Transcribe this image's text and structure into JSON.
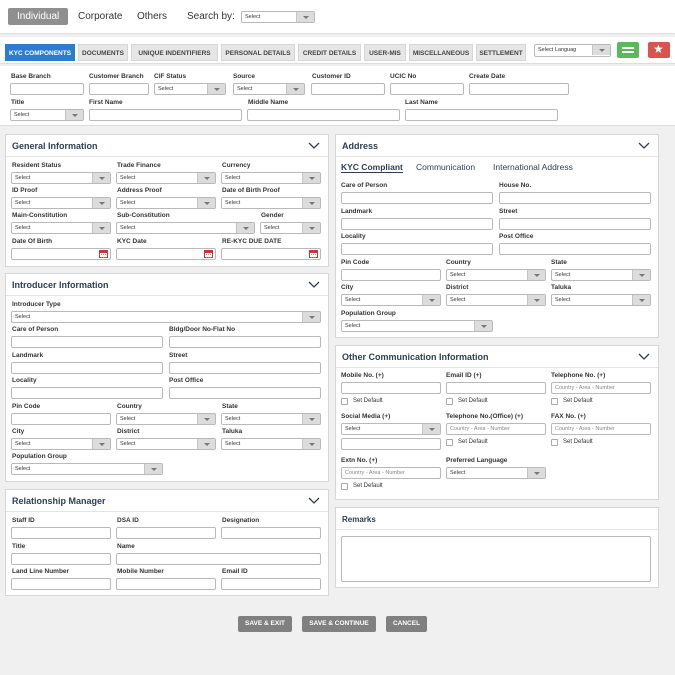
{
  "top_tabs": {
    "individual": "Individual",
    "corporate": "Corporate",
    "others": "Others",
    "search_by": "Search by:",
    "search_select": "Select"
  },
  "nav_tabs": [
    "KYC COMPONENTS",
    "DOCUMENTS",
    "UNIQUE INDENTIFIERS",
    "PERSONAL DETAILS",
    "CREDIT DETAILS",
    "USER-MIS",
    "MISCELLANEOUS",
    "SETTLEMENT"
  ],
  "language_select": "Select Languag",
  "select_text": "Select",
  "header_form": {
    "base_branch": "Base Branch",
    "customer_branch": "Customer Branch",
    "cif_status": "CIF Status",
    "source": "Source",
    "customer_id": "Customer ID",
    "ucic_no": "UCIC No",
    "create_date": "Create Date",
    "title": "Title",
    "first_name": "First Name",
    "middle_name": "Middle Name",
    "last_name": "Last Name"
  },
  "general": {
    "title": "General Information",
    "resident_status": "Resident Status",
    "trade_finance": "Trade Finance",
    "currency": "Currency",
    "id_proof": "ID Proof",
    "address_proof": "Address Proof",
    "dob_proof": "Date of Birth Proof",
    "main_constitution": "Main-Constitution",
    "sub_constitution": "Sub-Constitution",
    "gender": "Gender",
    "date_of_birth": "Date Of Birth",
    "kyc_date": "KYC Date",
    "rekyc_due": "RE-KYC DUE DATE"
  },
  "address": {
    "title": "Address",
    "tabs": [
      "KYC Compliant",
      "Communication",
      "International Address"
    ],
    "care_of": "Care of Person",
    "house_no": "House No.",
    "landmark": "Landmark",
    "street": "Street",
    "locality": "Locality",
    "post_office": "Post Office",
    "pin_code": "Pin Code",
    "country": "Country",
    "state": "State",
    "city": "City",
    "district": "District",
    "taluka": "Taluka",
    "population_group": "Population Group"
  },
  "introducer": {
    "title": "Introducer Information",
    "type": "Introducer Type",
    "care_of": "Care of Person",
    "bldg": "Bldg/Door No-Flat No",
    "landmark": "Landmark",
    "street": "Street",
    "locality": "Locality",
    "post_office": "Post Office",
    "pin_code": "Pin Code",
    "country": "Country",
    "state": "State",
    "city": "City",
    "district": "District",
    "taluka": "Taluka",
    "population_group": "Population Group"
  },
  "other_comm": {
    "title": "Other Communication Information",
    "mobile": "Mobile No. (+)",
    "email": "Email ID (+)",
    "telephone": "Telephone No. (+)",
    "set_default": "Set Default",
    "social": "Social Media (+)",
    "tel_office": "Telephone No.(Office) (+)",
    "fax": "FAX No. (+)",
    "extn": "Extn No. (+)",
    "preferred_language": "Preferred Language",
    "phone_placeholder": "Country - Area - Number"
  },
  "relationship": {
    "title": "Relationship Manager",
    "staff_id": "Staff ID",
    "dsa_id": "DSA ID",
    "designation": "Designation",
    "title_lbl": "Title",
    "name": "Name",
    "landline": "Land Line Number",
    "mobile": "Mobile Number",
    "email": "Email ID"
  },
  "remarks": {
    "title": "Remarks"
  },
  "buttons": {
    "save_exit": "SAVE & EXIT",
    "save_continue": "SAVE & CONTINUE",
    "cancel": "CANCEL"
  },
  "colors": {
    "accent_blue": "#2c7bd1",
    "green_button": "#5cb85c",
    "red_button": "#d9534f"
  }
}
